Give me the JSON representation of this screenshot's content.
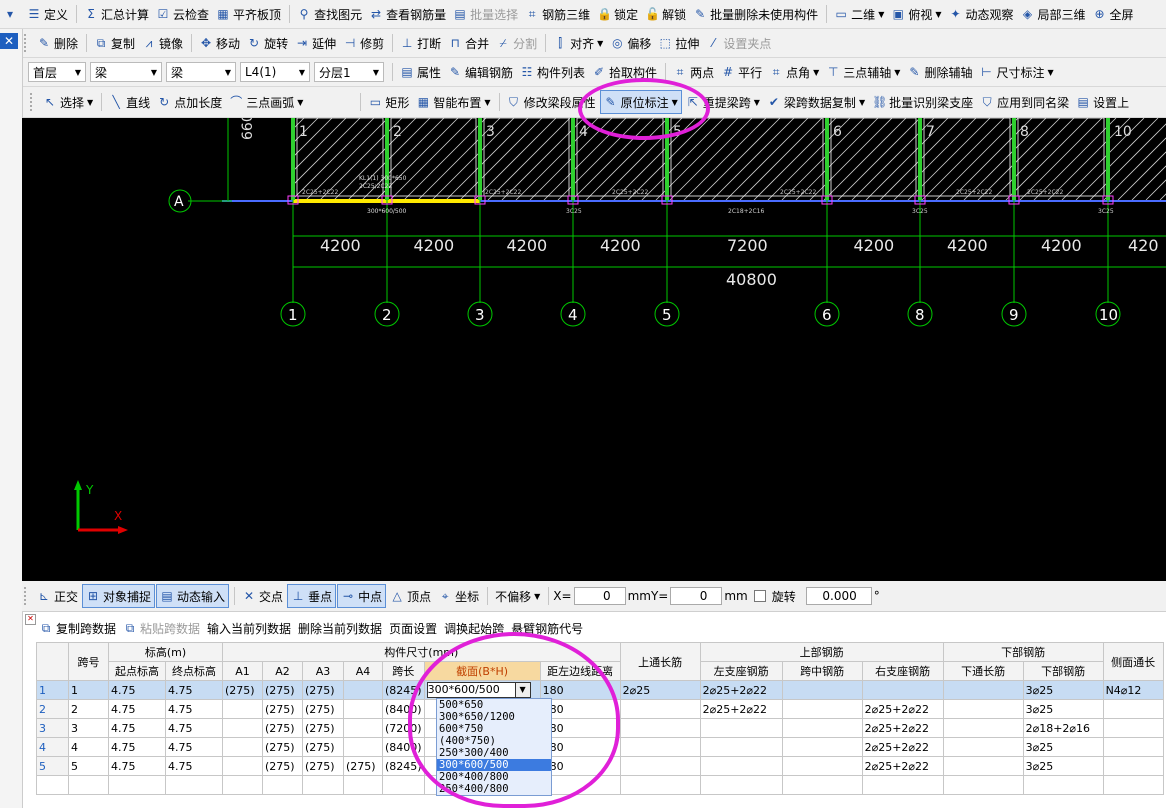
{
  "toolbar1": [
    {
      "icon": "▾",
      "label": ""
    },
    {
      "icon": "☰",
      "label": "定义"
    },
    {
      "icon": "Σ",
      "label": "汇总计算"
    },
    {
      "icon": "☑",
      "label": "云检查"
    },
    {
      "icon": "▦",
      "label": "平齐板顶"
    },
    {
      "icon": "⚲",
      "label": "查找图元"
    },
    {
      "icon": "⇄",
      "label": "查看钢筋量"
    },
    {
      "icon": "▤",
      "label": "批量选择",
      "disabled": true
    },
    {
      "icon": "⌗",
      "label": "钢筋三维"
    },
    {
      "icon": "🔒",
      "label": "锁定"
    },
    {
      "icon": "🔓",
      "label": "解锁"
    },
    {
      "icon": "✎",
      "label": "批量删除未使用构件"
    },
    {
      "icon": "▭",
      "label": "二维",
      "dropdown": true
    },
    {
      "icon": "▣",
      "label": "俯视",
      "dropdown": true
    },
    {
      "icon": "✦",
      "label": "动态观察"
    },
    {
      "icon": "◈",
      "label": "局部三维"
    },
    {
      "icon": "⊕",
      "label": "全屏"
    }
  ],
  "toolbar2": [
    {
      "icon": "✎",
      "label": "删除"
    },
    {
      "icon": "⧉",
      "label": "复制"
    },
    {
      "icon": "⩘",
      "label": "镜像"
    },
    {
      "icon": "✥",
      "label": "移动"
    },
    {
      "icon": "↻",
      "label": "旋转"
    },
    {
      "icon": "⇥",
      "label": "延伸"
    },
    {
      "icon": "⊣",
      "label": "修剪"
    },
    {
      "icon": "⊥",
      "label": "打断"
    },
    {
      "icon": "⊓",
      "label": "合并"
    },
    {
      "icon": "⌿",
      "label": "分割",
      "disabled": true
    },
    {
      "icon": "⫿",
      "label": "对齐",
      "dropdown": true
    },
    {
      "icon": "◎",
      "label": "偏移"
    },
    {
      "icon": "⬚",
      "label": "拉伸"
    },
    {
      "icon": "⁄",
      "label": "设置夹点",
      "disabled": true
    }
  ],
  "toolbar3": {
    "floor": "首层",
    "type": "梁",
    "subtype": "梁",
    "member": "L4(1)",
    "layer": "分层1",
    "items": [
      {
        "icon": "▤",
        "label": "属性"
      },
      {
        "icon": "✎",
        "label": "编辑钢筋"
      },
      {
        "icon": "☷",
        "label": "构件列表"
      },
      {
        "icon": "✐",
        "label": "拾取构件"
      },
      {
        "icon": "⌗",
        "label": "两点"
      },
      {
        "icon": "#",
        "label": "平行"
      },
      {
        "icon": "⌗",
        "label": "点角",
        "dropdown": true
      },
      {
        "icon": "⊤",
        "label": "三点辅轴",
        "dropdown": true
      },
      {
        "icon": "✎",
        "label": "删除辅轴"
      },
      {
        "icon": "⊢",
        "label": "尺寸标注",
        "dropdown": true
      }
    ]
  },
  "toolbar4": [
    {
      "icon": "↖",
      "label": "选择",
      "dropdown": true
    },
    {
      "icon": "╲",
      "label": "直线"
    },
    {
      "icon": "↻",
      "label": "点加长度"
    },
    {
      "icon": "⌒",
      "label": "三点画弧",
      "dropdown": true
    },
    {
      "icon": "▭",
      "label": "矩形"
    },
    {
      "icon": "▦",
      "label": "智能布置",
      "dropdown": true
    },
    {
      "icon": "⛉",
      "label": "修改梁段属性"
    },
    {
      "icon": "✎",
      "label": "原位标注",
      "dropdown": true,
      "active": true
    },
    {
      "icon": "⇱",
      "label": "重提梁跨",
      "dropdown": true
    },
    {
      "icon": "✔",
      "label": "梁跨数据复制",
      "dropdown": true
    },
    {
      "icon": "⛓",
      "label": "批量识别梁支座"
    },
    {
      "icon": "⛉",
      "label": "应用到同名梁"
    },
    {
      "icon": "▤",
      "label": "设置上"
    }
  ],
  "canvas": {
    "axis_a": "A",
    "dim_left": "660",
    "spans_top": [
      "4200",
      "4200",
      "4200",
      "4200",
      "7200",
      "4200",
      "4200",
      "4200",
      "420"
    ],
    "total_length": "40800",
    "axes_bottom": [
      "1",
      "2",
      "3",
      "4",
      "5",
      "6",
      "8",
      "9",
      "10"
    ],
    "axes_top": [
      "1",
      "2",
      "3",
      "4",
      "5",
      "6",
      "7",
      "8",
      "10"
    ],
    "beam_label": "KL1(1) 300*650",
    "beam_label2": "2C25;2C22",
    "beam_section": "300*600/500",
    "rebar_notes": [
      "2C25+2C22",
      "2C25+2C22",
      "2C25+2C22",
      "2C25+2C22",
      "2C25+2C22",
      "2C25+2C22"
    ],
    "bottom_notes": [
      "3C25",
      "2C18+2C16",
      "3C25",
      "3C25"
    ],
    "ucs_x": "X",
    "ucs_y": "Y"
  },
  "snapbar": {
    "items": [
      {
        "icon": "⊾",
        "label": "正交"
      },
      {
        "icon": "⊞",
        "label": "对象捕捉",
        "active": true
      },
      {
        "icon": "▤",
        "label": "动态输入",
        "active": true
      },
      {
        "icon": "✕",
        "label": "交点"
      },
      {
        "icon": "⊥",
        "label": "垂点",
        "active": true
      },
      {
        "icon": "⊸",
        "label": "中点",
        "active": true
      },
      {
        "icon": "△",
        "label": "顶点"
      },
      {
        "icon": "⌖",
        "label": "坐标"
      }
    ],
    "offset": "不偏移",
    "x_label": "X=",
    "x_value": "0",
    "unit1": "mm",
    "y_label": "Y=",
    "y_value": "0",
    "unit2": "mm",
    "rotate_label": "旋转",
    "rotate_value": "0.000",
    "deg": "°"
  },
  "tabletb": [
    {
      "label": "复制跨数据",
      "icon": "⧉"
    },
    {
      "label": "粘贴跨数据",
      "icon": "⧉",
      "disabled": true
    },
    {
      "label": "输入当前列数据"
    },
    {
      "label": "删除当前列数据"
    },
    {
      "label": "页面设置"
    },
    {
      "label": "调换起始跨"
    },
    {
      "label": "悬臂钢筋代号"
    }
  ],
  "grid": {
    "h_span": "跨号",
    "h_elev": "标高(m)",
    "h_start": "起点标高",
    "h_end": "终点标高",
    "h_size": "构件尺寸(mm)",
    "h_a1": "A1",
    "h_a2": "A2",
    "h_a3": "A3",
    "h_a4": "A4",
    "h_len": "跨长",
    "h_sec": "截面(B*H)",
    "h_dist": "距左边线距离",
    "h_toplong": "上通长筋",
    "h_top": "上部钢筋",
    "h_left": "左支座钢筋",
    "h_mid": "跨中钢筋",
    "h_right": "右支座钢筋",
    "h_bot": "下部钢筋",
    "h_botlong": "下通长筋",
    "h_botbar": "下部钢筋",
    "h_side": "侧面通长",
    "rows": [
      {
        "n": "1",
        "span": "1",
        "start": "4.75",
        "end": "4.75",
        "a1": "(275)",
        "a2": "(275)",
        "a3": "(275)",
        "a4": "",
        "len": "(8245)",
        "sec": "300*600/500",
        "dist": "180",
        "toplong": "2⌀25",
        "left": "2⌀25+2⌀22",
        "mid": "",
        "right": "",
        "botlong": "",
        "botbar": "3⌀25",
        "side": "N4⌀12"
      },
      {
        "n": "2",
        "span": "2",
        "start": "4.75",
        "end": "4.75",
        "a1": "",
        "a2": "(275)",
        "a3": "(275)",
        "a4": "",
        "len": "(8400)",
        "sec": "",
        "dist": "180",
        "toplong": "",
        "left": "2⌀25+2⌀22",
        "mid": "",
        "right": "2⌀25+2⌀22",
        "botlong": "",
        "botbar": "3⌀25",
        "side": ""
      },
      {
        "n": "3",
        "span": "3",
        "start": "4.75",
        "end": "4.75",
        "a1": "",
        "a2": "(275)",
        "a3": "(275)",
        "a4": "",
        "len": "(7200)",
        "sec": "",
        "dist": "180",
        "toplong": "",
        "left": "",
        "mid": "",
        "right": "2⌀25+2⌀22",
        "botlong": "",
        "botbar": "2⌀18+2⌀16",
        "side": ""
      },
      {
        "n": "4",
        "span": "4",
        "start": "4.75",
        "end": "4.75",
        "a1": "",
        "a2": "(275)",
        "a3": "(275)",
        "a4": "",
        "len": "(8400)",
        "sec": "",
        "dist": "180",
        "toplong": "",
        "left": "",
        "mid": "",
        "right": "2⌀25+2⌀22",
        "botlong": "",
        "botbar": "3⌀25",
        "side": ""
      },
      {
        "n": "5",
        "span": "5",
        "start": "4.75",
        "end": "4.75",
        "a1": "",
        "a2": "(275)",
        "a3": "(275)",
        "a4": "(275)",
        "len": "(8245)",
        "sec": "",
        "dist": "180",
        "toplong": "",
        "left": "",
        "mid": "",
        "right": "2⌀25+2⌀22",
        "botlong": "",
        "botbar": "3⌀25",
        "side": ""
      }
    ],
    "dropdown": [
      "500*650",
      "300*650/1200",
      "600*750",
      "(400*750)",
      "250*300/400",
      "300*600/500",
      "200*400/800",
      "250*400/800"
    ],
    "dropdown_selected": 5
  }
}
